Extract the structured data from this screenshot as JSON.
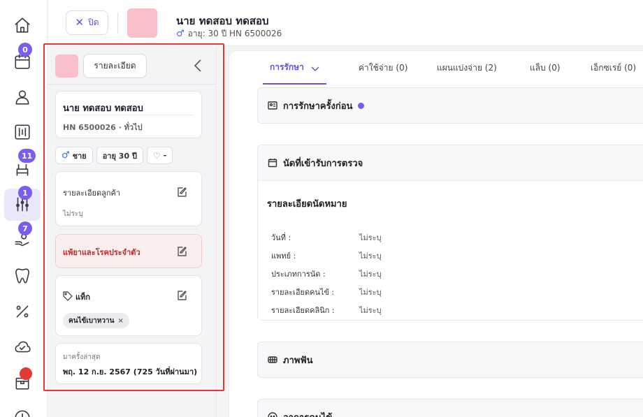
{
  "rail": {
    "badges": {
      "calendar": "0",
      "treatment": "11",
      "dental_chart": "1",
      "payment": "7"
    }
  },
  "topbar": {
    "close_label": "ปิด",
    "patient_name": "นาย ทดสอบ ทดสอบ",
    "age_hn": "อายุ: 30 ปี  HN 6500026"
  },
  "panel": {
    "detail_label": "รายละเอียด",
    "patient_name": "นาย ทดสอบ ทดสอบ",
    "hn_line": "HN 6500026 · ทั่วไป",
    "chips": {
      "gender": "ชาย",
      "age": "อายุ 30 ปี",
      "health": "-"
    },
    "customer_detail": {
      "title": "รายละเอียดลูกค้า",
      "value": "ไม่ระบุ"
    },
    "allergy": {
      "title": "แพ้ยาและโรคประจำตัว"
    },
    "tags": {
      "title": "แท็ก",
      "items": [
        "คนไข้เบาหวาน"
      ]
    },
    "last_visit": {
      "label": "มาครั้งล่าสุด",
      "value": "พฤ. 12 ก.ย. 2567 (725 วันที่ผ่านมา)"
    }
  },
  "tabs": [
    {
      "label": "การรักษา"
    },
    {
      "label": "ค่าใช้จ่าย (0)"
    },
    {
      "label": "แผนแบ่งจ่าย (2)"
    },
    {
      "label": "แล็บ (0)"
    },
    {
      "label": "เอ็กซเรย์ (0)"
    }
  ],
  "sections": {
    "previous_treatment": "การรักษาครั้งก่อน",
    "appointment": "นัดที่เข้ารับการตรวจ",
    "teeth_image": "ภาพฟัน",
    "symptoms": "อาการคนไข้"
  },
  "appointment": {
    "title": "รายละเอียดนัดหมาย",
    "rows": [
      {
        "label": "วันที่ :",
        "value": "ไม่ระบุ"
      },
      {
        "label": "แพทย์ :",
        "value": "ไม่ระบุ"
      },
      {
        "label": "ประเภทการนัด :",
        "value": "ไม่ระบุ"
      },
      {
        "label": "รายละเอียดคนไข้ :",
        "value": "ไม่ระบุ"
      },
      {
        "label": "รายละเอียดคลินิก :",
        "value": "ไม่ระบุ"
      }
    ]
  }
}
